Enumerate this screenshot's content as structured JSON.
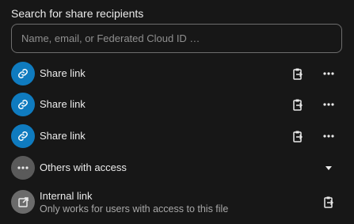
{
  "sharing": {
    "heading": "Search for share recipients",
    "search_placeholder": "Name, email, or Federated Cloud ID …",
    "links": [
      {
        "label": "Share link"
      },
      {
        "label": "Share link"
      },
      {
        "label": "Share link"
      }
    ],
    "others": {
      "label": "Others with access"
    },
    "internal": {
      "title": "Internal link",
      "subtitle": "Only works for users with access to this file"
    }
  },
  "colors": {
    "background": "#171717",
    "link_avatar": "#0f7bbf",
    "neutral_avatar": "#5a5a5a",
    "border": "#6e6e6e",
    "muted_text": "#a8a8a8"
  },
  "icons": {
    "link": "link-icon",
    "copy": "clipboard-copy-icon",
    "more": "more-horizontal-icon",
    "caret": "triangle-down-icon",
    "external": "open-in-new-icon"
  }
}
